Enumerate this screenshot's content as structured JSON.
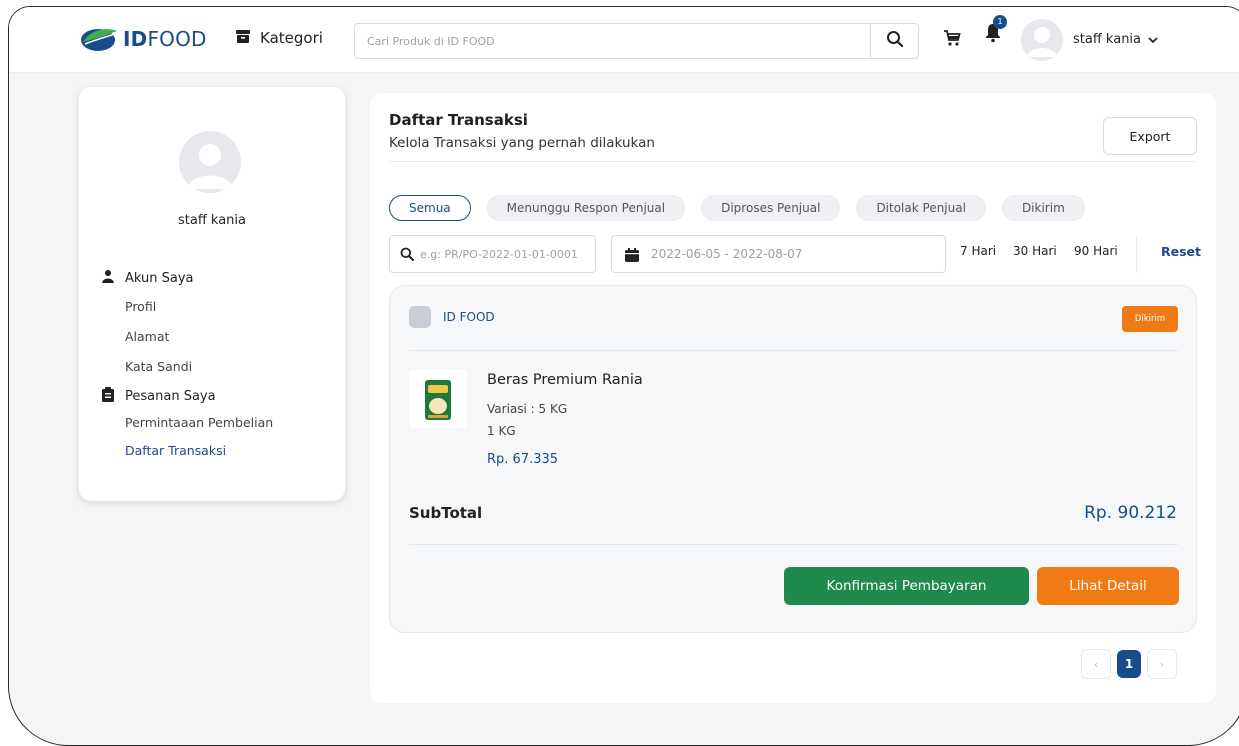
{
  "header": {
    "logo_text_id": "ID",
    "logo_text_food": "FOOD",
    "kategori_label": "Kategori",
    "search_placeholder": "Cari Produk di ID FOOD",
    "notification_count": "1",
    "username": "staff kania"
  },
  "sidebar": {
    "username": "staff kania",
    "sections": [
      {
        "label": "Akun Saya",
        "icon": "person-icon",
        "items": [
          "Profil",
          "Alamat",
          "Kata Sandi"
        ]
      },
      {
        "label": "Pesanan Saya",
        "icon": "clipboard-icon",
        "items": [
          "Permintaaan Pembelian",
          "Daftar Transaksi"
        ]
      }
    ],
    "active_item": "Daftar Transaksi"
  },
  "main": {
    "title": "Daftar Transaksi",
    "subtitle": "Kelola Transaksi yang pernah dilakukan",
    "export_label": "Export",
    "tabs": [
      {
        "label": "Semua",
        "active": true
      },
      {
        "label": "Menunggu Respon Penjual",
        "active": false
      },
      {
        "label": "Diproses Penjual",
        "active": false
      },
      {
        "label": "Ditolak Penjual",
        "active": false
      },
      {
        "label": "Dikirim",
        "active": false
      }
    ],
    "filter": {
      "search_placeholder": "e.g: PR/PO-2022-01-01-0001",
      "date_range": "2022-06-05 - 2022-08-07",
      "quick_ranges": [
        "7 Hari",
        "30 Hari",
        "90 Hari"
      ],
      "reset_label": "Reset"
    },
    "transaction": {
      "seller": "ID FOOD",
      "status": "Dikirim",
      "product_name": "Beras Premium Rania",
      "variant": "Variasi : 5 KG",
      "unit": "1 KG",
      "price": "Rp. 67.335",
      "subtotal_label": "SubTotal",
      "subtotal_value": "Rp. 90.212",
      "confirm_label": "Konfirmasi Pembayaran",
      "detail_label": "Lihat Detail"
    },
    "pagination": {
      "prev": "‹",
      "current": "1",
      "next": "›"
    }
  },
  "colors": {
    "brand_blue": "#1a4c8b",
    "brand_green": "#1f8a4c",
    "accent_orange": "#ef7a16"
  }
}
